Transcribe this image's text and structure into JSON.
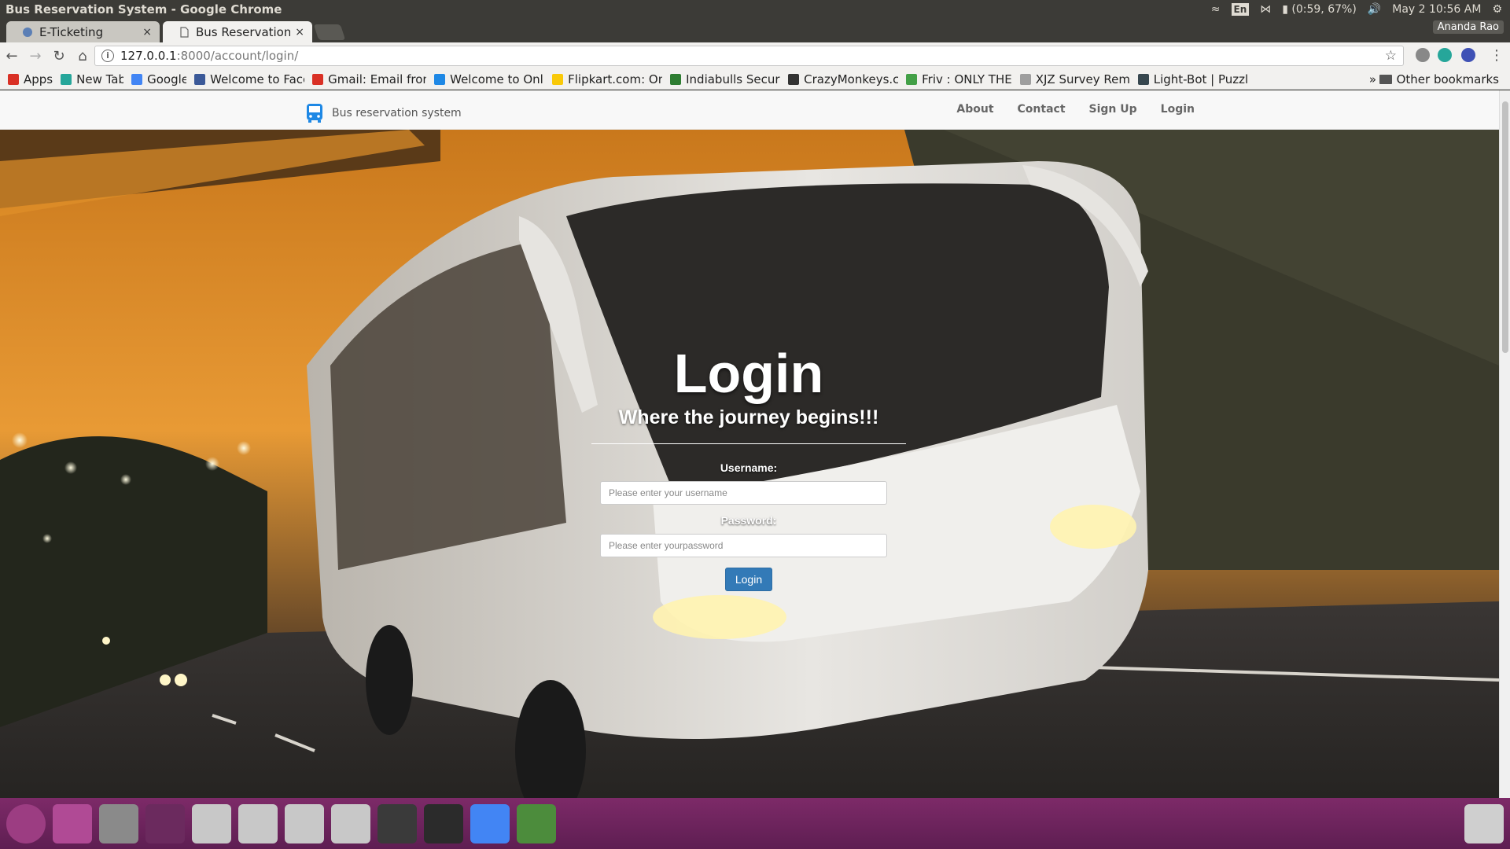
{
  "os": {
    "window_title": "Bus Reservation System - Google Chrome",
    "lang": "En",
    "battery": "(0:59, 67%)",
    "clock": "May 2 10:56 AM",
    "user": "Ananda Rao"
  },
  "tabs": [
    {
      "label": "E-Ticketing",
      "close": "×"
    },
    {
      "label": "Bus Reservation Sy",
      "close": "×"
    }
  ],
  "url": {
    "host": "127.0.0.1",
    "path": ":8000/account/login/"
  },
  "bookmarks": [
    {
      "label": "Apps",
      "icon": "apps-grid-icon",
      "color": "#d93025"
    },
    {
      "label": "New Tab",
      "icon": "newtab-icon",
      "color": "#26a69a"
    },
    {
      "label": "Google",
      "icon": "google-icon",
      "color": "#4285f4"
    },
    {
      "label": "Welcome to Face",
      "icon": "facebook-icon",
      "color": "#3b5998"
    },
    {
      "label": "Gmail: Email fron",
      "icon": "gmail-icon",
      "color": "#d93025"
    },
    {
      "label": "Welcome to Onli",
      "icon": "globe-icon",
      "color": "#1e88e5"
    },
    {
      "label": "Flipkart.com: On",
      "icon": "flipkart-icon",
      "color": "#f9c908"
    },
    {
      "label": "Indiabulls Securi",
      "icon": "indiabulls-icon",
      "color": "#2e7d32"
    },
    {
      "label": "CrazyMonkeys.co",
      "icon": "monkey-icon",
      "color": "#333333"
    },
    {
      "label": "Friv : ONLY THE",
      "icon": "friv-icon",
      "color": "#43a047"
    },
    {
      "label": "XJZ Survey Remo",
      "icon": "page-icon",
      "color": "#9e9e9e"
    },
    {
      "label": "Light-Bot | Puzzl",
      "icon": "shield-icon",
      "color": "#37474f"
    }
  ],
  "other_bookmarks": "Other bookmarks",
  "site": {
    "brand": "Bus reservation system",
    "nav": [
      "About",
      "Contact",
      "Sign Up",
      "Login"
    ]
  },
  "login": {
    "title": "Login",
    "subtitle": "Where the journey begins!!!",
    "username_label": "Username:",
    "username_placeholder": "Please enter your username",
    "password_label": "Password:",
    "password_placeholder": "Please enter yourpassword",
    "button": "Login"
  },
  "dock": [
    {
      "name": "ubuntu-dash-icon",
      "color": "#9c3d82"
    },
    {
      "name": "window-icon",
      "color": "#b04a95"
    },
    {
      "name": "archive-icon",
      "color": "#8a8a8a"
    },
    {
      "name": "workspace-switcher-icon",
      "color": "#6b2a5e"
    },
    {
      "name": "drive-icon-1",
      "color": "#c8c8c8"
    },
    {
      "name": "drive-icon-2",
      "color": "#c8c8c8"
    },
    {
      "name": "drive-icon-3",
      "color": "#c8c8c8"
    },
    {
      "name": "drive-icon-4",
      "color": "#c8c8c8"
    },
    {
      "name": "sublime-text-icon",
      "color": "#3a3a3a"
    },
    {
      "name": "terminal-icon",
      "color": "#2b2b2b"
    },
    {
      "name": "chrome-icon",
      "color": "#4285f4"
    },
    {
      "name": "software-updater-icon",
      "color": "#4c8c3c"
    }
  ]
}
